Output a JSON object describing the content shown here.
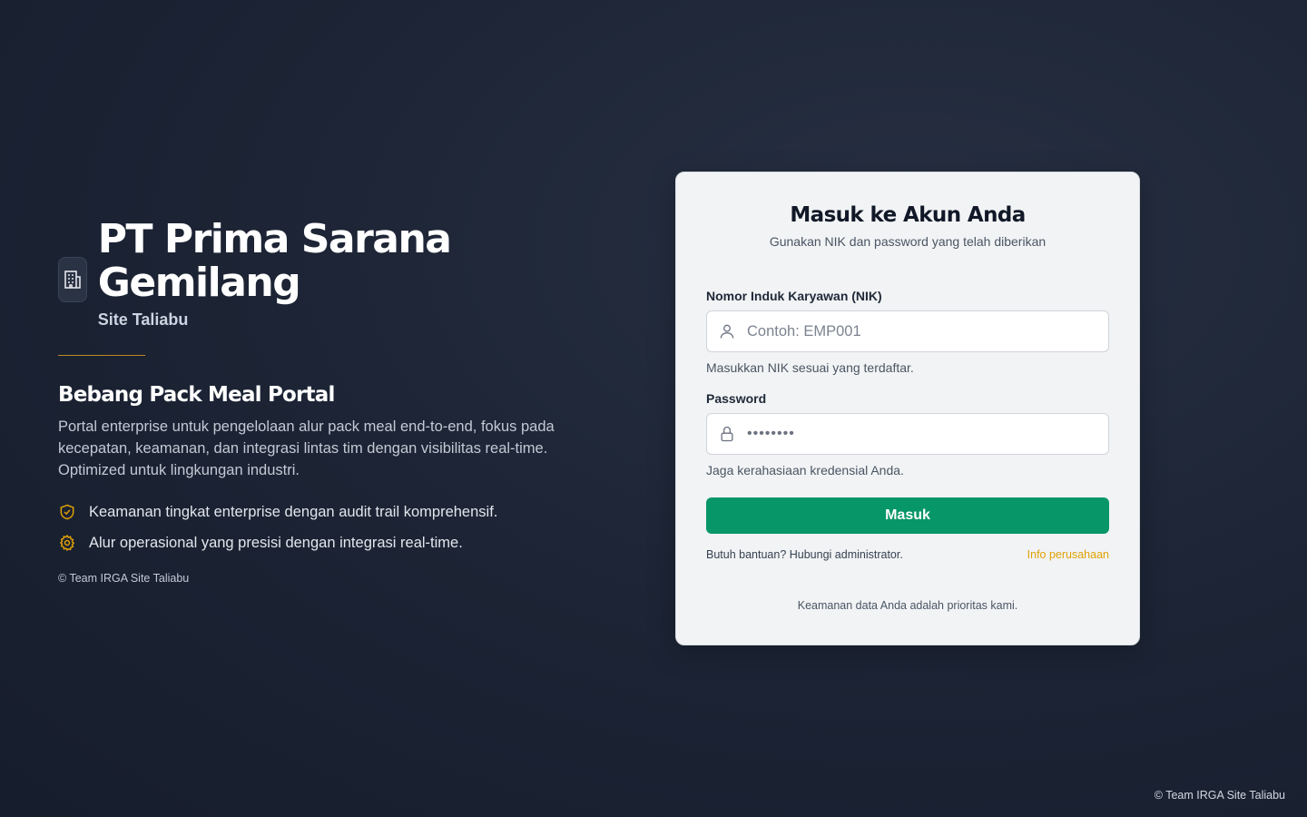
{
  "left": {
    "company_name": "PT Prima Sarana Gemilang",
    "site": "Site Taliabu",
    "portal_title": "Bebang Pack Meal Portal",
    "portal_description": "Portal enterprise untuk pengelolaan alur pack meal end-to-end, fokus pada kecepatan, keamanan, dan integrasi lintas tim dengan visibilitas real-time. Optimized untuk lingkungan industri.",
    "features": [
      {
        "icon": "shield-check-icon",
        "text": "Keamanan tingkat enterprise dengan audit trail komprehensif."
      },
      {
        "icon": "gear-icon",
        "text": "Alur operasional yang presisi dengan integrasi real-time."
      }
    ],
    "footer": "© Team IRGA Site Taliabu",
    "brand_icon": "building-icon"
  },
  "login": {
    "title": "Masuk ke Akun Anda",
    "subtitle": "Gunakan NIK dan password yang telah diberikan",
    "nik_label": "Nomor Induk Karyawan (NIK)",
    "nik_placeholder": "Contoh: EMP001",
    "nik_value": "",
    "nik_hint": "Masukkan NIK sesuai yang terdaftar.",
    "password_label": "Password",
    "password_value": "••••••••",
    "password_hint": "Jaga kerahasiaan kredensial Anda.",
    "submit_label": "Masuk",
    "help_text": "Butuh bantuan? Hubungi administrator.",
    "info_link": "Info perusahaan",
    "security_note": "Keamanan data Anda adalah prioritas kami."
  },
  "page_footer": "© Team IRGA Site Taliabu",
  "colors": {
    "primary_button": "#079667",
    "accent_gold": "#e0a106",
    "background": "#1d2536"
  }
}
